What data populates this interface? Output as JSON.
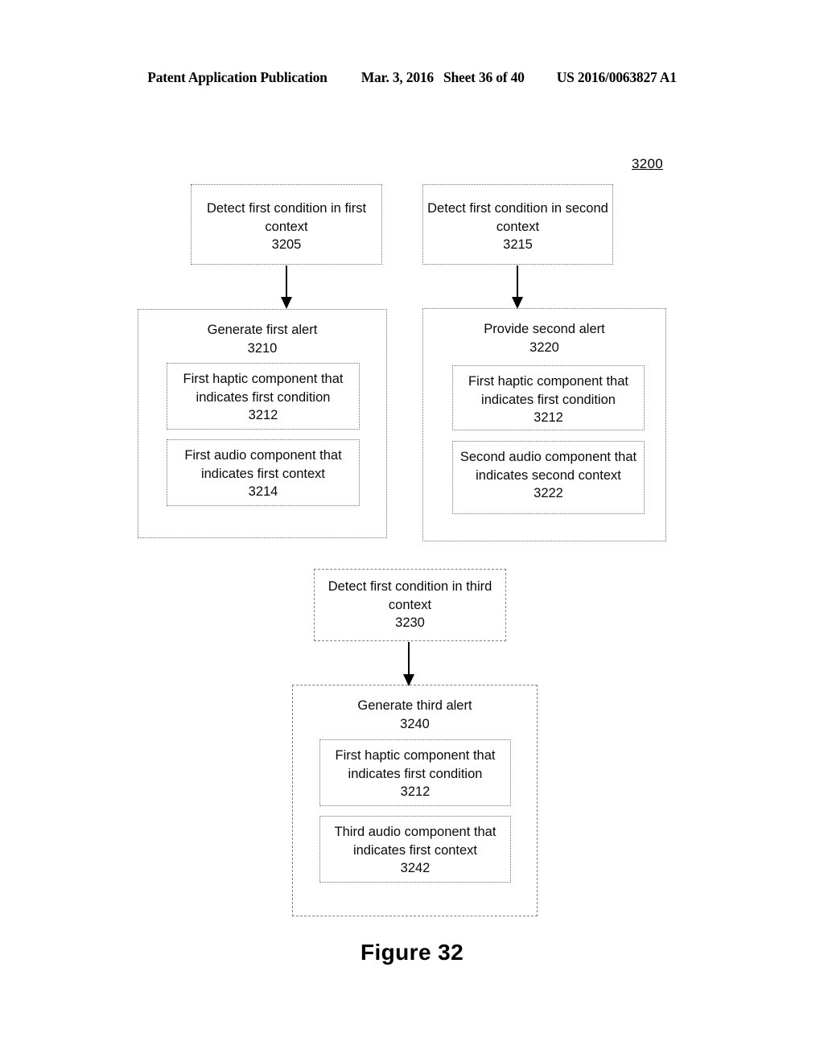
{
  "header": {
    "publication": "Patent Application Publication",
    "date": "Mar. 3, 2016",
    "sheet": "Sheet 36 of 40",
    "patent_number": "US 2016/0063827 A1"
  },
  "figure": {
    "reference_numeral": "3200",
    "caption": "Figure 32"
  },
  "flow": {
    "step_3205": {
      "text": "Detect first condition in first context",
      "numeral": "3205"
    },
    "step_3215": {
      "text": "Detect first condition in second context",
      "numeral": "3215"
    },
    "step_3230": {
      "text": "Detect first condition in third context",
      "numeral": "3230"
    },
    "group_3210": {
      "title": "Generate first alert",
      "numeral": "3210",
      "components": [
        {
          "text": "First haptic component that indicates first condition",
          "numeral": "3212"
        },
        {
          "text": "First audio component that indicates first context",
          "numeral": "3214"
        }
      ]
    },
    "group_3220": {
      "title": "Provide second alert",
      "numeral": "3220",
      "components": [
        {
          "text": "First haptic component that indicates first condition",
          "numeral": "3212"
        },
        {
          "text": "Second audio component that indicates second context",
          "numeral": "3222"
        }
      ]
    },
    "group_3240": {
      "title": "Generate third alert",
      "numeral": "3240",
      "components": [
        {
          "text": "First haptic component that indicates first condition",
          "numeral": "3212"
        },
        {
          "text": "Third audio component that indicates first context",
          "numeral": "3242"
        }
      ]
    }
  }
}
